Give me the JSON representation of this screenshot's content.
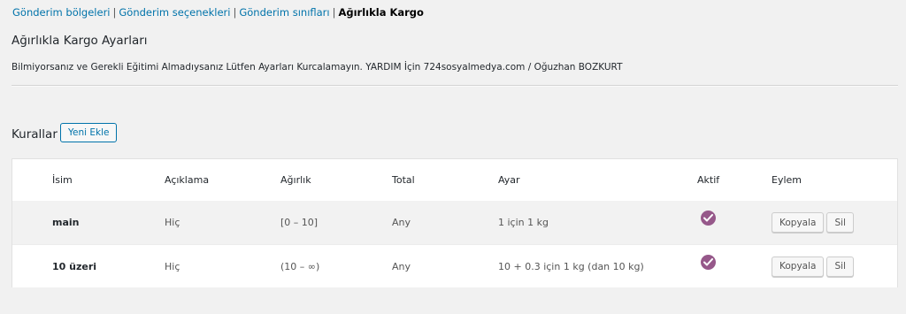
{
  "subnav": {
    "links": [
      "Gönderim bölgeleri",
      "Gönderim seçenekleri",
      "Gönderim sınıfları"
    ],
    "separator": "|",
    "current": "Ağırlıkla Kargo"
  },
  "page": {
    "title": "Ağırlıkla Kargo Ayarları",
    "notice": "Bilmiyorsanız ve Gerekli Eğitimi Almadıysanız Lütfen Ayarları Kurcalamayın. YARDIM İçin 724sosyalmedya.com / Oğuzhan BOZKURT"
  },
  "rules": {
    "label": "Kurallar",
    "add_button": "Yeni Ekle"
  },
  "table": {
    "headers": [
      "İsim",
      "Açıklama",
      "Ağırlık",
      "Total",
      "Ayar",
      "Aktif",
      "Eylem"
    ],
    "rows": [
      {
        "name": "main",
        "description": "Hiç",
        "weight": "[0 – 10]",
        "total": "Any",
        "setting": "1 için 1 kg",
        "active": true,
        "copy": "Kopyala",
        "delete": "Sil"
      },
      {
        "name": "10 üzeri",
        "description": "Hiç",
        "weight": "(10 – ∞)",
        "total": "Any",
        "setting": "10 + 0.3 için 1 kg (dan 10 kg)",
        "active": true,
        "copy": "Kopyala",
        "delete": "Sil"
      }
    ]
  },
  "colors": {
    "accent": "#0073aa",
    "active_check": "#96588a"
  },
  "icons": {
    "active": "check-circle-icon"
  }
}
